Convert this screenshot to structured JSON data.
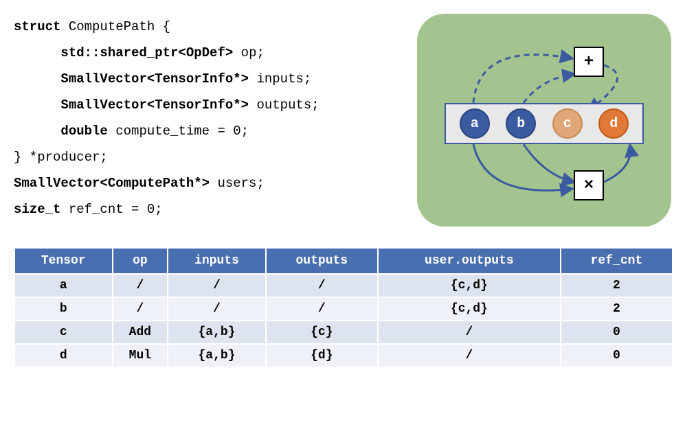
{
  "code": {
    "l0a": "struct",
    "l0b": " ComputePath {",
    "l1a": "std::shared_ptr<OpDef>",
    "l1b": " op;",
    "l2a": "SmallVector<TensorInfo*>",
    "l2b": " inputs;",
    "l3a": "SmallVector<TensorInfo*>",
    "l3b": " outputs;",
    "l4a": "double",
    "l4b": " compute_time = 0;",
    "l5": "} *producer;",
    "l6a": "SmallVector<ComputePath*>",
    "l6b": " users;",
    "l7a": "size_t",
    "l7b": " ref_cnt = 0;"
  },
  "diagram": {
    "nodes": {
      "a": "a",
      "b": "b",
      "c": "c",
      "d": "d"
    },
    "ops": {
      "plus": "+",
      "mul": "×"
    }
  },
  "table": {
    "headers": [
      "Tensor",
      "op",
      "inputs",
      "outputs",
      "user.outputs",
      "ref_cnt"
    ],
    "rows": [
      {
        "tensor": "a",
        "op": "/",
        "inputs": "/",
        "outputs": "/",
        "user_outputs": "{c,d}",
        "ref_cnt": "2"
      },
      {
        "tensor": "b",
        "op": "/",
        "inputs": "/",
        "outputs": "/",
        "user_outputs": "{c,d}",
        "ref_cnt": "2"
      },
      {
        "tensor": "c",
        "op": "Add",
        "inputs": "{a,b}",
        "outputs": "{c}",
        "user_outputs": "/",
        "ref_cnt": "0"
      },
      {
        "tensor": "d",
        "op": "Mul",
        "inputs": "{a,b}",
        "outputs": "{d}",
        "user_outputs": "/",
        "ref_cnt": "0"
      }
    ]
  }
}
